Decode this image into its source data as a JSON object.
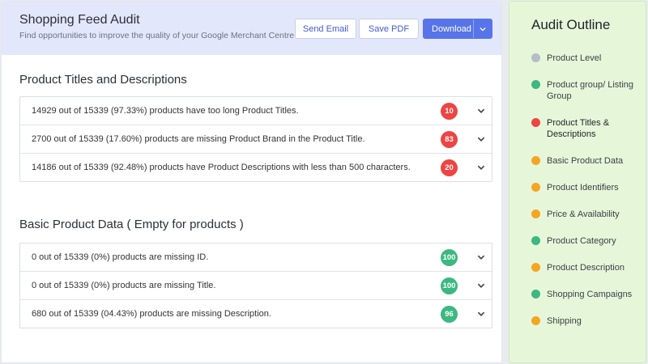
{
  "header": {
    "title": "Shopping Feed Audit",
    "subtitle": "Find opportunities to improve the quality of your Google Merchant Centre feeds.",
    "send_email_label": "Send Email",
    "save_pdf_label": "Save PDF",
    "download_label": "Download"
  },
  "sections": [
    {
      "title": "Product Titles and Descriptions",
      "rows": [
        {
          "text": "14929 out of 15339 (97.33%) products have too long Product Titles.",
          "score": "10",
          "status_color": "#ef4444"
        },
        {
          "text": "2700 out of 15339 (17.60%) products are missing Product Brand in the Product Title.",
          "score": "83",
          "status_color": "#ef4444"
        },
        {
          "text": "14186 out of 15339 (92.48%) products have Product Descriptions with less than 500 characters.",
          "score": "20",
          "status_color": "#ef4444"
        }
      ]
    },
    {
      "title": "Basic Product Data ( Empty for products )",
      "rows": [
        {
          "text": "0 out of 15339 (0%) products are missing ID.",
          "score": "100",
          "status_color": "#3cb880"
        },
        {
          "text": "0 out of 15339 (0%) products are missing Title.",
          "score": "100",
          "status_color": "#3cb880"
        },
        {
          "text": "680 out of 15339 (04.43%) products are missing Description.",
          "score": "96",
          "status_color": "#3cb880"
        }
      ]
    }
  ],
  "outline": {
    "title": "Audit Outline",
    "items": [
      {
        "label": "Product Level",
        "color": "#b6bcc8"
      },
      {
        "label": "Product group/ Listing Group",
        "color": "#3cb880"
      },
      {
        "label": "Product Titles & Descriptions",
        "color": "#ef4444",
        "active": true
      },
      {
        "label": "Basic Product Data",
        "color": "#f5a524"
      },
      {
        "label": "Product Identifiers",
        "color": "#f5a524"
      },
      {
        "label": "Price & Availability",
        "color": "#f5a524"
      },
      {
        "label": "Product Category",
        "color": "#3cb880"
      },
      {
        "label": "Product Description",
        "color": "#f5a524"
      },
      {
        "label": "Shopping Campaigns",
        "color": "#3cb880"
      },
      {
        "label": "Shipping",
        "color": "#f5a524"
      }
    ]
  }
}
